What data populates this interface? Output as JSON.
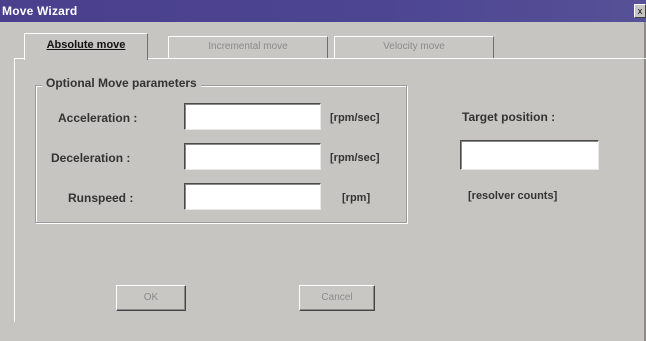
{
  "window": {
    "title": "Move Wizard",
    "close_glyph": "x"
  },
  "tabs": [
    {
      "label": "Absolute move"
    },
    {
      "label": "Incremental move"
    },
    {
      "label": "Velocity move"
    }
  ],
  "group": {
    "title": "Optional Move parameters"
  },
  "fields": {
    "acceleration": {
      "label": "Acceleration :",
      "unit": "[rpm/sec]",
      "value": ""
    },
    "deceleration": {
      "label": "Deceleration :",
      "unit": "[rpm/sec]",
      "value": ""
    },
    "runspeed": {
      "label": "Runspeed :",
      "unit": "[rpm]",
      "value": ""
    }
  },
  "target": {
    "label": "Target position :",
    "unit": "[resolver counts]",
    "value": ""
  },
  "buttons": {
    "ok": "OK",
    "cancel": "Cancel"
  }
}
